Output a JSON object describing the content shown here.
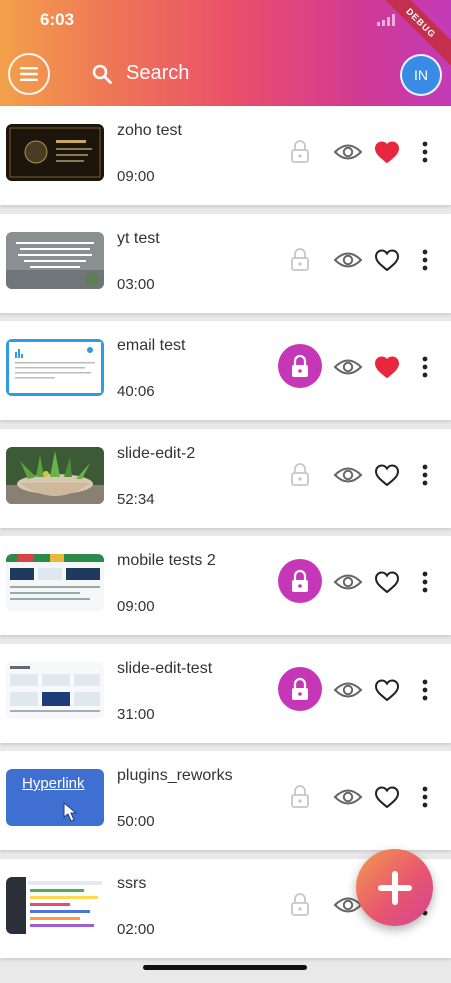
{
  "status": {
    "time": "6:03",
    "debug_badge": "DEBUG"
  },
  "header": {
    "search_label": "Search",
    "avatar_initials": "IN"
  },
  "items": [
    {
      "title": "zoho test",
      "duration": "09:00",
      "locked": false,
      "favorite": true,
      "thumb": "zoho"
    },
    {
      "title": "yt test",
      "duration": "03:00",
      "locked": false,
      "favorite": false,
      "thumb": "yt"
    },
    {
      "title": "email test",
      "duration": "40:06",
      "locked": true,
      "favorite": true,
      "thumb": "email"
    },
    {
      "title": "slide-edit-2",
      "duration": "52:34",
      "locked": false,
      "favorite": false,
      "thumb": "plant"
    },
    {
      "title": "mobile tests 2",
      "duration": "09:00",
      "locked": true,
      "favorite": false,
      "thumb": "dash1"
    },
    {
      "title": "slide-edit-test",
      "duration": "31:00",
      "locked": true,
      "favorite": false,
      "thumb": "dash2"
    },
    {
      "title": "plugins_reworks",
      "duration": "50:00",
      "locked": false,
      "favorite": false,
      "thumb": "hyperlink",
      "thumb_text": "Hyperlink"
    },
    {
      "title": "ssrs",
      "duration": "02:00",
      "locked": false,
      "favorite": false,
      "thumb": "ssrs"
    }
  ],
  "colors": {
    "accent": "#c637b8",
    "favorite": "#e8263e",
    "avatar": "#3a8be6"
  }
}
